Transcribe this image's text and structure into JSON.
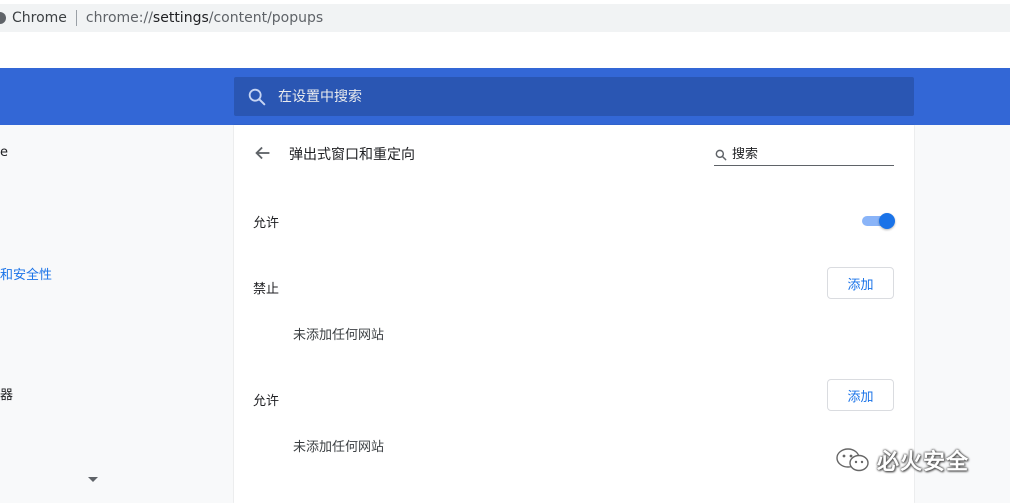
{
  "addressbar": {
    "site_name": "Chrome",
    "url_scheme": "chrome://",
    "url_host": "settings",
    "url_path": "/content/popups"
  },
  "header": {
    "search_placeholder": "在设置中搜索"
  },
  "sidebar": {
    "items": [
      {
        "label": "e"
      },
      {
        "label": "和安全性"
      },
      {
        "label": "器"
      }
    ]
  },
  "page": {
    "title": "弹出式窗口和重定向",
    "search_placeholder": "搜索",
    "default_setting_label": "允许",
    "default_setting_enabled": true,
    "sections": [
      {
        "label": "禁止",
        "add_label": "添加",
        "empty_text": "未添加任何网站"
      },
      {
        "label": "允许",
        "add_label": "添加",
        "empty_text": "未添加任何网站"
      }
    ]
  },
  "watermark": {
    "text": "必火安全"
  },
  "colors": {
    "header_blue": "#3367d6",
    "search_blue": "#2a56b3",
    "accent": "#1a73e8"
  },
  "icons": {
    "back": "arrow-left-icon",
    "search": "search-icon",
    "dropdown": "caret-down-icon"
  }
}
